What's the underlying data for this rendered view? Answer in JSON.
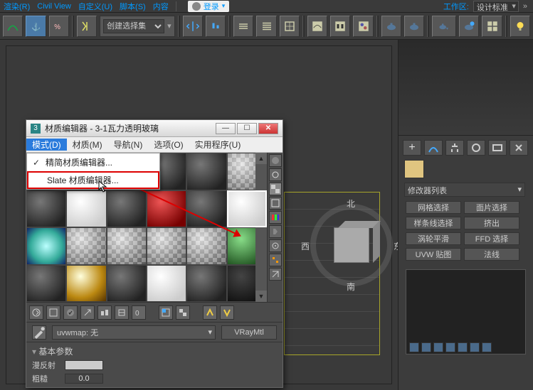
{
  "top_menu": {
    "render": "渲染(R)",
    "civil_view": "Civil View",
    "custom": "自定义(U)",
    "script": "脚本(S)",
    "content": "内容",
    "login": "登录",
    "workspace_label": "工作区:",
    "workspace_value": "设计标准"
  },
  "toolbar": {
    "selection_set": "创建选择集"
  },
  "viewcube": {
    "n": "北",
    "s": "南",
    "e": "东",
    "w": "西"
  },
  "cmd_panel": {
    "modifier_list": "修改器列表",
    "btns": {
      "mesh_select": "网格选择",
      "face_select": "面片选择",
      "spline_select": "样条线选择",
      "extrude": "挤出",
      "turbosmooth": "涡轮平滑",
      "ffd_select": "FFD 选择",
      "uvw_map": "UVW 贴图",
      "normal": "法线"
    }
  },
  "material_editor": {
    "title": "材质编辑器 - 3-1瓦力透明玻璃",
    "menu": {
      "mode": "模式(D)",
      "material": "材质(M)",
      "navigate": "导航(N)",
      "options": "选项(O)",
      "utilities": "实用程序(U)"
    },
    "mode_menu": {
      "compact": "精简材质编辑器...",
      "slate": "Slate 材质编辑器..."
    },
    "mat_name": "uvwmap: 无",
    "mat_type": "VRayMtl",
    "params": {
      "header": "基本参数",
      "diffuse": "漫反射",
      "rough": "粗糙",
      "rough_val": "0.0"
    }
  }
}
